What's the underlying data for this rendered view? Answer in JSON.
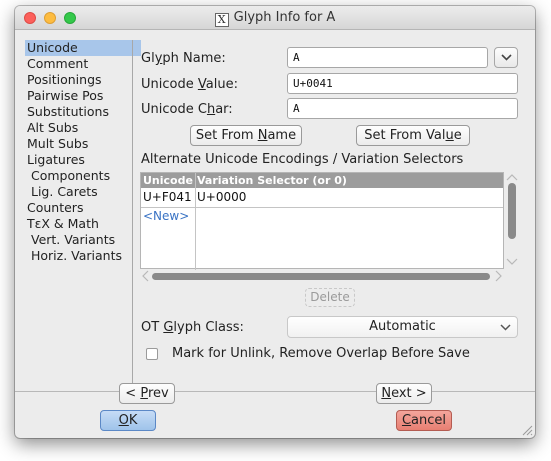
{
  "window": {
    "title": "Glyph Info for A"
  },
  "sidebar": {
    "items": [
      {
        "label": "Unicode"
      },
      {
        "label": "Comment"
      },
      {
        "label": "Positionings"
      },
      {
        "label": "Pairwise Pos"
      },
      {
        "label": "Substitutions"
      },
      {
        "label": "Alt Subs"
      },
      {
        "label": "Mult Subs"
      },
      {
        "label": "Ligatures"
      },
      {
        "label": "Components"
      },
      {
        "label": "Lig. Carets"
      },
      {
        "label": "Counters"
      },
      {
        "label": "TεX & Math"
      },
      {
        "label": "Vert. Variants"
      },
      {
        "label": "Horiz. Variants"
      }
    ],
    "selected": "Unicode"
  },
  "form": {
    "glyph_name_label_pre": "Gl",
    "glyph_name_label_u": "y",
    "glyph_name_label_post": "ph Name:",
    "glyph_name_value": "A",
    "unicode_value_label_pre": "Unicode ",
    "unicode_value_label_u": "V",
    "unicode_value_label_post": "alue:",
    "unicode_value_value": "U+0041",
    "unicode_char_label_pre": "Unicode C",
    "unicode_char_label_u": "h",
    "unicode_char_label_post": "ar:",
    "unicode_char_value": "A",
    "set_from_name_pre": "Set From ",
    "set_from_name_u": "N",
    "set_from_name_post": "ame",
    "set_from_value_pre": "Set From Val",
    "set_from_value_u": "u",
    "set_from_value_post": "e"
  },
  "alt_encodings": {
    "heading": "Alternate Unicode Encodings / Variation Selectors",
    "columns": [
      "Unicode",
      "Variation Selector (or 0)"
    ],
    "rows": [
      {
        "unicode": "U+F041",
        "selector": "U+0000"
      }
    ],
    "new_label": "<New>",
    "delete_label": "Delete"
  },
  "ot": {
    "label_pre": "OT ",
    "label_u": "G",
    "label_post": "lyph Class:",
    "value": "Automatic"
  },
  "checkbox": {
    "label": "Mark for Unlink, Remove Overlap Before Save",
    "checked": false
  },
  "nav": {
    "prev_pre": "< ",
    "prev_u": "P",
    "prev_post": "rev",
    "next_u": "N",
    "next_post": "ext >",
    "ok_u": "O",
    "ok_post": "K",
    "cancel_u": "C",
    "cancel_post": "ancel"
  },
  "colors": {
    "selected_sidebar": "#a8c6ea",
    "ok_button": "#9fc3ea",
    "cancel_button": "#e87f72",
    "table_header": "#9c9c9c",
    "new_link": "#3a73c4"
  }
}
